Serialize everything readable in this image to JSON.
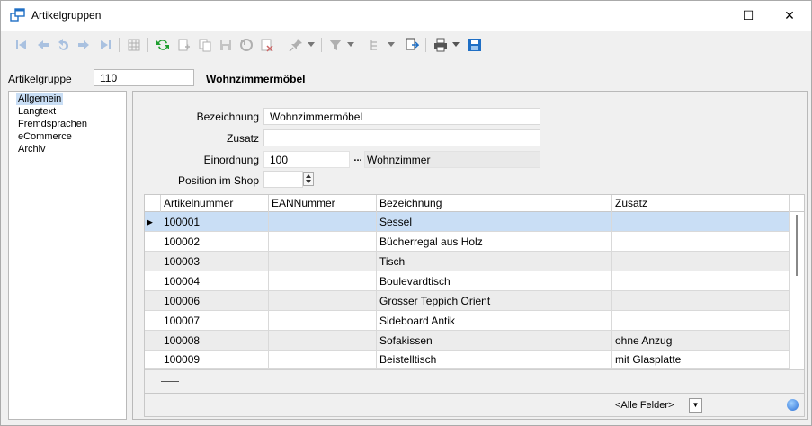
{
  "window": {
    "title": "Artikelgruppen",
    "maximize_glyph": "☐",
    "close_glyph": "✕"
  },
  "toolbar": {
    "icons": [
      "first-record-icon",
      "previous-record-icon",
      "undo-icon",
      "next-record-icon",
      "last-record-icon",
      "table-view-icon",
      "refresh-icon",
      "new-record-icon",
      "copy-record-icon",
      "save-icon",
      "undo-changes-icon",
      "delete-icon",
      "pin-icon",
      "filter-icon",
      "tree-icon",
      "export-icon",
      "print-icon",
      "save-layout-icon"
    ]
  },
  "key": {
    "label": "Artikelgruppe",
    "value": "110",
    "name": "Wohnzimmermöbel"
  },
  "sidebar": {
    "items": [
      {
        "label": "Allgemein",
        "active": true
      },
      {
        "label": "Langtext"
      },
      {
        "label": "Fremdsprachen"
      },
      {
        "label": "eCommerce"
      },
      {
        "label": "Archiv"
      }
    ]
  },
  "form": {
    "bezeichnung_label": "Bezeichnung",
    "bezeichnung_value": "Wohnzimmermöbel",
    "zusatz_label": "Zusatz",
    "zusatz_value": "",
    "einordnung_label": "Einordnung",
    "einordnung_value": "100",
    "einordnung_button": "...",
    "einordnung_name": "Wohnzimmer",
    "position_label": "Position im Shop",
    "position_value": ""
  },
  "grid": {
    "columns": [
      "Artikelnummer",
      "EANNummer",
      "Bezeichnung",
      "Zusatz"
    ],
    "rows": [
      {
        "nr": "100001",
        "ean": "",
        "bez": "Sessel",
        "zusatz": ""
      },
      {
        "nr": "100002",
        "ean": "",
        "bez": "Bücherregal aus Holz",
        "zusatz": ""
      },
      {
        "nr": "100003",
        "ean": "",
        "bez": "Tisch",
        "zusatz": ""
      },
      {
        "nr": "100004",
        "ean": "",
        "bez": "Boulevardtisch",
        "zusatz": ""
      },
      {
        "nr": "100006",
        "ean": "",
        "bez": "Grosser Teppich Orient",
        "zusatz": ""
      },
      {
        "nr": "100007",
        "ean": "",
        "bez": "Sideboard Antik",
        "zusatz": ""
      },
      {
        "nr": "100008",
        "ean": "",
        "bez": "Sofakissen",
        "zusatz": "ohne Anzug"
      },
      {
        "nr": "100009",
        "ean": "",
        "bez": "Beistelltisch",
        "zusatz": "mit Glasplatte"
      }
    ],
    "selected_row": 0,
    "row_indicator": "▶"
  },
  "filter": {
    "field_select": "<Alle Felder>",
    "dropdown_glyph": "▼",
    "search_value": ""
  }
}
